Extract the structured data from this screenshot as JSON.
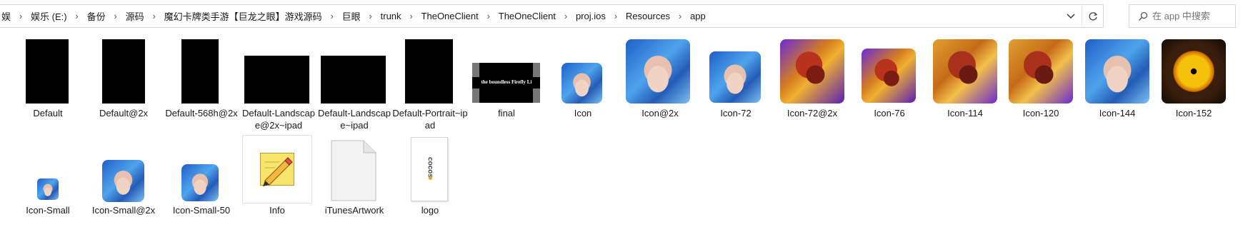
{
  "address_bar": {
    "crumbs": [
      "娱",
      "娱乐 (E:)",
      "备份",
      "源码",
      "魔幻卡牌类手游【巨龙之眼】游戏源码",
      "巨眼",
      "trunk",
      "TheOneClient",
      "TheOneClient",
      "proj.ios",
      "Resources",
      "app"
    ]
  },
  "search": {
    "placeholder": "在 app 中搜索"
  },
  "files": [
    {
      "name": "Default"
    },
    {
      "name": "Default@2x"
    },
    {
      "name": "Default-568h@2x"
    },
    {
      "name": "Default-Landscape@2x~ipad"
    },
    {
      "name": "Default-Landscape~ipad"
    },
    {
      "name": "Default-Portrait~ipad"
    },
    {
      "name": "final",
      "thumb_text": "the boundless Firefly Li"
    },
    {
      "name": "Icon"
    },
    {
      "name": "Icon@2x"
    },
    {
      "name": "Icon-72"
    },
    {
      "name": "Icon-72@2x"
    },
    {
      "name": "Icon-76"
    },
    {
      "name": "Icon-114"
    },
    {
      "name": "Icon-120"
    },
    {
      "name": "Icon-144"
    },
    {
      "name": "Icon-152"
    },
    {
      "name": "Icon-Small"
    },
    {
      "name": "Icon-Small@2x"
    },
    {
      "name": "Icon-Small-50"
    },
    {
      "name": "Info"
    },
    {
      "name": "iTunesArtwork"
    },
    {
      "name": "logo",
      "thumb_text": "cocos"
    }
  ]
}
